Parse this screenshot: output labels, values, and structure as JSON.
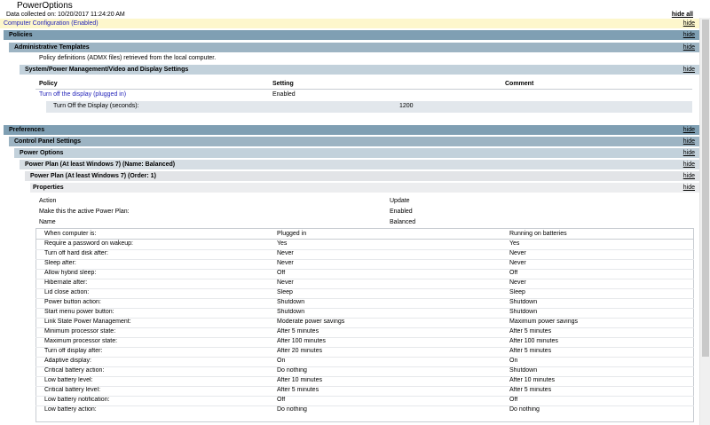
{
  "header": {
    "title": "PowerOptions",
    "collected": "Data collected on: 10/20/2017 11:24:20 AM",
    "hide_all": "hide all"
  },
  "hide_label": "hide",
  "sections": {
    "computer_config": "Computer Configuration (Enabled)",
    "policies": "Policies",
    "admin_templates": "Administrative Templates",
    "admx_note": "Policy definitions (ADMX files) retrieved from the local computer.",
    "video_settings": "System/Power Management/Video and Display Settings",
    "preferences": "Preferences",
    "control_panel": "Control Panel Settings",
    "power_options": "Power Options",
    "plan_balanced": "Power Plan (At least Windows 7) (Name: Balanced)",
    "plan_order": "Power Plan (At least Windows 7) (Order: 1)",
    "properties": "Properties"
  },
  "policy_table": {
    "headers": [
      "Policy",
      "Setting",
      "Comment"
    ],
    "row": {
      "policy": "Turn off the display (plugged in)",
      "setting": "Enabled",
      "comment": ""
    },
    "sub": {
      "label": "Turn Off the Display (seconds):",
      "value": "1200"
    }
  },
  "properties": {
    "kv": [
      {
        "key": "Action",
        "value": "Update"
      },
      {
        "key": "Make this the active Power Plan:",
        "value": "Enabled"
      },
      {
        "key": "Name",
        "value": "Balanced"
      }
    ],
    "grid_headers": [
      "When computer is:",
      "Plugged in",
      "Running on batteries"
    ],
    "rows": [
      [
        "Require a password on wakeup:",
        "Yes",
        "Yes"
      ],
      [
        "Turn off hard disk after:",
        "Never",
        "Never"
      ],
      [
        "Sleep after:",
        "Never",
        "Never"
      ],
      [
        "Allow hybrid sleep:",
        "Off",
        "Off"
      ],
      [
        "Hibernate after:",
        "Never",
        "Never"
      ],
      [
        "Lid close action:",
        "Sleep",
        "Sleep"
      ],
      [
        "Power button action:",
        "Shutdown",
        "Shutdown"
      ],
      [
        "Start menu power button:",
        "Shutdown",
        "Shutdown"
      ],
      [
        "Link State Power Management:",
        "Moderate power savings",
        "Maximum power savings"
      ],
      [
        "Minimum processor state:",
        "After 5 minutes",
        "After 5 minutes"
      ],
      [
        "Maximum processor state:",
        "After 100 minutes",
        "After 100 minutes"
      ],
      [
        "Turn off display after:",
        "After 20 minutes",
        "After 5 minutes"
      ],
      [
        "Adaptive display:",
        "On",
        "On"
      ],
      [
        "Critical battery action:",
        "Do nothing",
        "Shutdown"
      ],
      [
        "Low battery level:",
        "After 10 minutes",
        "After 10 minutes"
      ],
      [
        "Critical battery level:",
        "After 5 minutes",
        "After 5 minutes"
      ],
      [
        "Low battery notification:",
        "Off",
        "Off"
      ],
      [
        "Low battery action:",
        "Do nothing",
        "Do nothing"
      ]
    ]
  },
  "colors": {
    "computer_config_bg": "#fdf7cc",
    "level1_bg": "#7f9fb3",
    "level2_bg": "#9db4c3",
    "level3_bg": "#c2d1db",
    "level4_bg": "#d6dee4",
    "level5_bg": "#e2e4e7",
    "level6_bg": "#ecedef",
    "sub_bg": "#e2e7ec",
    "link": "#1f1fb8"
  }
}
